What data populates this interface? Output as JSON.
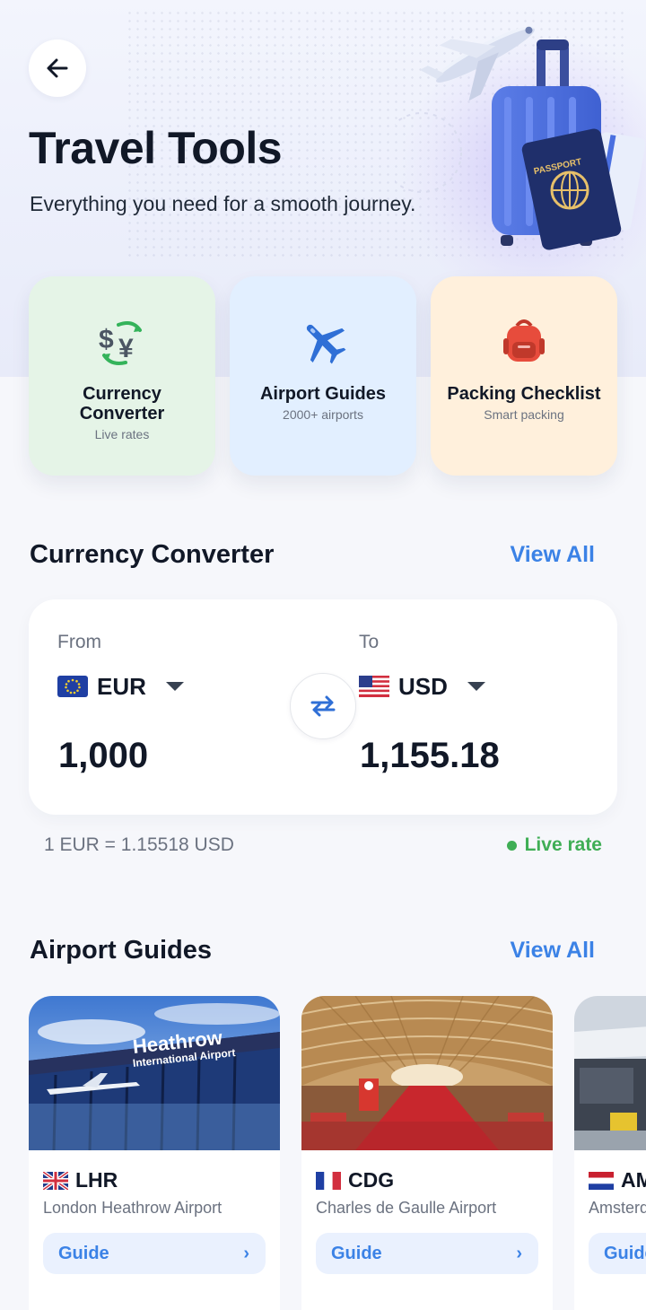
{
  "header": {
    "title": "Travel Tools",
    "subtitle": "Everything you need for a smooth journey."
  },
  "tools": [
    {
      "name": "Currency Converter",
      "sub": "Live rates",
      "icon": "currency-exchange-icon"
    },
    {
      "name": "Airport Guides",
      "sub": "2000+ airports",
      "icon": "airplane-icon"
    },
    {
      "name": "Packing Checklist",
      "sub": "Smart packing",
      "icon": "backpack-icon"
    }
  ],
  "currency": {
    "section_title": "Currency Converter",
    "view_all": "View All",
    "from_label": "From",
    "to_label": "To",
    "from_code": "EUR",
    "to_code": "USD",
    "from_amount": "1,000",
    "to_amount": "1,155.18",
    "rate": "1 EUR = 1.15518 USD",
    "live_label": "Live rate"
  },
  "airports": {
    "section_title": "Airport Guides",
    "view_all": "View All",
    "items": [
      {
        "code": "LHR",
        "name": "London Heathrow Airport",
        "guide": "Guide",
        "image_text_1": "Heathrow",
        "image_text_2": "International Airport"
      },
      {
        "code": "CDG",
        "name": "Charles de Gaulle Airport",
        "guide": "Guide"
      },
      {
        "code": "AMS",
        "name": "Amsterdam Airport Schiphol",
        "guide": "Guide"
      }
    ]
  },
  "colors": {
    "accent": "#3b82e6",
    "live": "#3fae55",
    "background": "#f6f7fb"
  }
}
